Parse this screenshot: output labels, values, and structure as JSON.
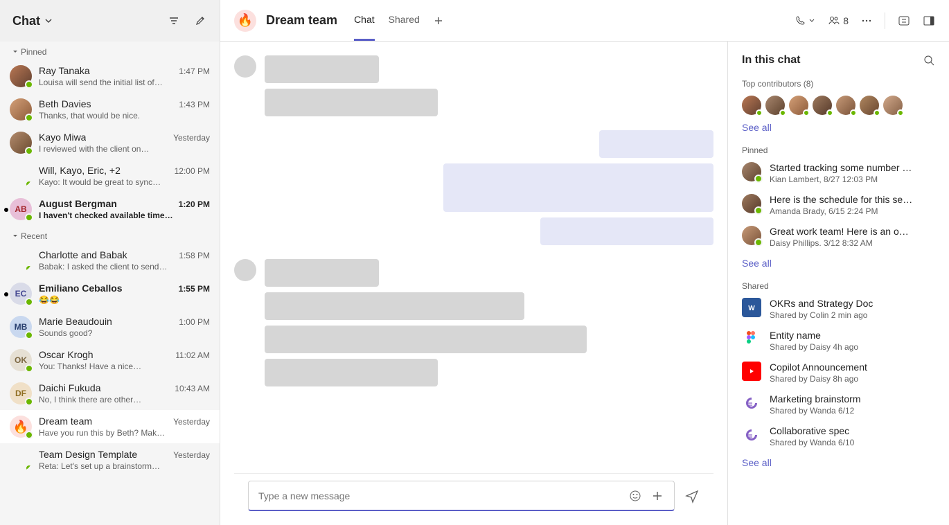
{
  "sidebar": {
    "title": "Chat",
    "sections": {
      "pinned_label": "Pinned",
      "recent_label": "Recent"
    },
    "pinned": [
      {
        "name": "Ray Tanaka",
        "preview": "Louisa will send the initial list of…",
        "time": "1:47 PM",
        "avatar": "photo1",
        "unread": false
      },
      {
        "name": "Beth Davies",
        "preview": "Thanks, that would be nice.",
        "time": "1:43 PM",
        "avatar": "photo2",
        "unread": false
      },
      {
        "name": "Kayo Miwa",
        "preview": "I reviewed with the client on…",
        "time": "Yesterday",
        "avatar": "photo3",
        "unread": false
      },
      {
        "name": "Will, Kayo, Eric, +2",
        "preview": "Kayo: It would be great to sync…",
        "time": "12:00 PM",
        "avatar": "split",
        "unread": false
      },
      {
        "name": "August Bergman",
        "preview": "I haven't checked available time…",
        "time": "1:20 PM",
        "avatar": "initials-ab",
        "initials": "AB",
        "unread": true
      }
    ],
    "recent": [
      {
        "name": "Charlotte and Babak",
        "preview": "Babak: I asked the client to send…",
        "time": "1:58 PM",
        "avatar": "split",
        "unread": false
      },
      {
        "name": "Emiliano Ceballos",
        "preview": "😂😂",
        "time": "1:55 PM",
        "avatar": "initials-ec",
        "initials": "EC",
        "unread": true
      },
      {
        "name": "Marie Beaudouin",
        "preview": "Sounds good?",
        "time": "1:00 PM",
        "avatar": "initials-mb",
        "initials": "MB",
        "unread": false
      },
      {
        "name": "Oscar Krogh",
        "preview": "You: Thanks! Have a nice…",
        "time": "11:02 AM",
        "avatar": "initials-ok",
        "initials": "OK",
        "unread": false
      },
      {
        "name": "Daichi Fukuda",
        "preview": "No, I think there are other…",
        "time": "10:43 AM",
        "avatar": "initials-df",
        "initials": "DF",
        "unread": false
      },
      {
        "name": "Dream team",
        "preview": "Have you run this by Beth? Mak…",
        "time": "Yesterday",
        "avatar": "fire",
        "initials": "🔥",
        "unread": false,
        "active": true
      },
      {
        "name": "Team Design Template",
        "preview": "Reta: Let's set up a brainstorm…",
        "time": "Yesterday",
        "avatar": "split",
        "unread": false
      }
    ]
  },
  "header": {
    "room_title": "Dream team",
    "room_icon": "🔥",
    "tabs": [
      {
        "label": "Chat",
        "active": true
      },
      {
        "label": "Shared",
        "active": false
      }
    ],
    "participants_count": "8"
  },
  "composer": {
    "placeholder": "Type a new message"
  },
  "right_panel": {
    "title": "In this chat",
    "contributors_label": "Top contributors (8)",
    "see_all": "See all",
    "pinned_label": "Pinned",
    "pinned": [
      {
        "title": "Started tracking some number …",
        "sub": "Kian Lambert, 8/27 12:03 PM",
        "avatar": "photo4"
      },
      {
        "title": "Here is the schedule for this se…",
        "sub": "Amanda Brady, 6/15 2:24 PM",
        "avatar": "photo5"
      },
      {
        "title": "Great work team! Here is an o…",
        "sub": "Daisy Phillips. 3/12 8:32 AM",
        "avatar": "photo6"
      }
    ],
    "shared_label": "Shared",
    "shared": [
      {
        "title": "OKRs and Strategy Doc",
        "sub": "Shared by Colin 2 min ago",
        "icon": "word"
      },
      {
        "title": "Entity name",
        "sub": "Shared by Daisy 4h ago",
        "icon": "figma"
      },
      {
        "title": "Copilot Announcement",
        "sub": "Shared by Daisy 8h ago",
        "icon": "youtube"
      },
      {
        "title": "Marketing brainstorm",
        "sub": "Shared by Wanda 6/12",
        "icon": "loop"
      },
      {
        "title": "Collaborative spec",
        "sub": "Shared by Wanda 6/10",
        "icon": "loop"
      }
    ]
  }
}
